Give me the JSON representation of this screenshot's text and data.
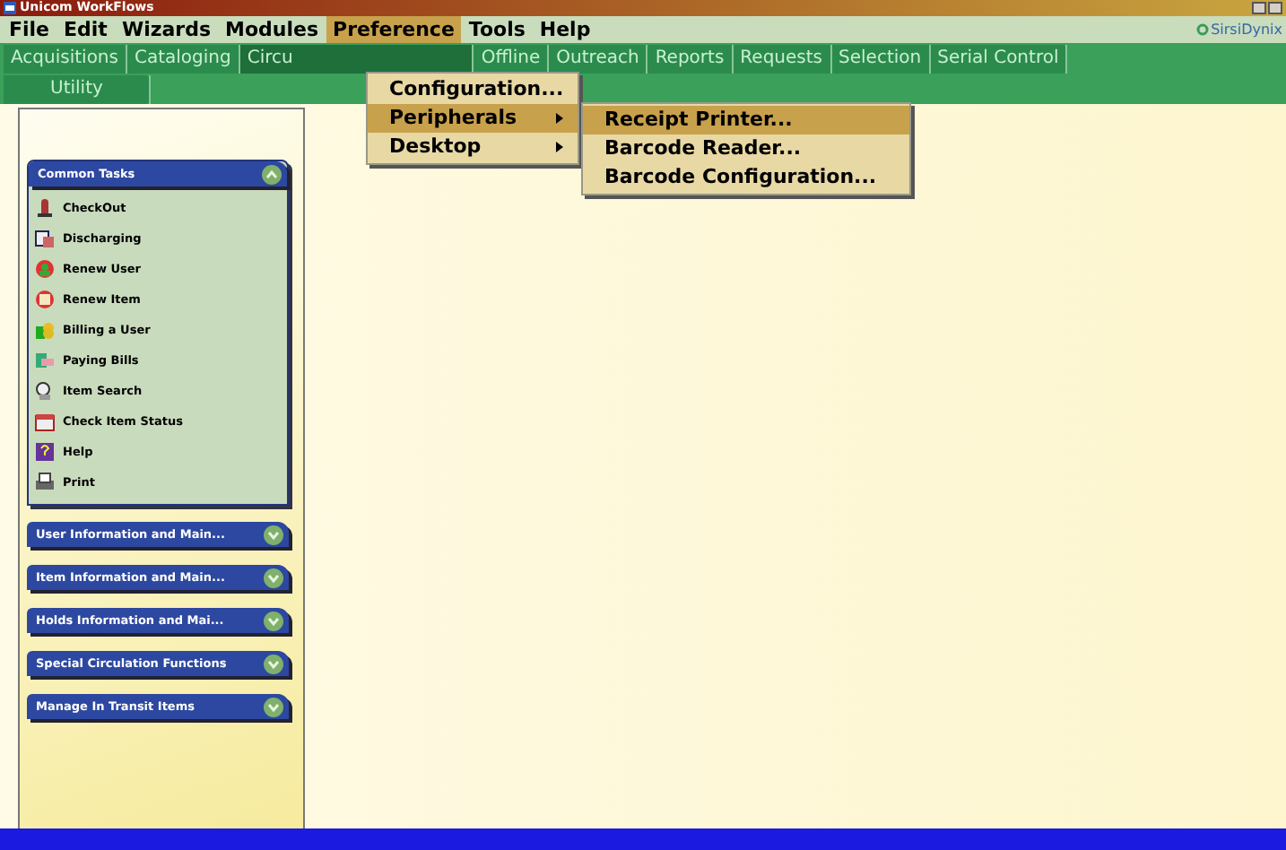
{
  "window": {
    "title": "Unicom WorkFlows",
    "logo": "SirsiDynix"
  },
  "menubar": [
    {
      "label": "File",
      "selected": false
    },
    {
      "label": "Edit",
      "selected": false
    },
    {
      "label": "Wizards",
      "selected": false
    },
    {
      "label": "Modules",
      "selected": false
    },
    {
      "label": "Preference",
      "selected": true
    },
    {
      "label": "Tools",
      "selected": false
    },
    {
      "label": "Help",
      "selected": false
    }
  ],
  "tabs": [
    [
      {
        "label": "Acquisitions",
        "selected": false
      },
      {
        "label": "Cataloging",
        "selected": false
      },
      {
        "label": "Circu",
        "selected": true
      },
      {
        "label": "Offline",
        "selected": false
      },
      {
        "label": "Outreach",
        "selected": false
      },
      {
        "label": "Reports",
        "selected": false
      },
      {
        "label": "Requests",
        "selected": false
      },
      {
        "label": "Selection",
        "selected": false
      },
      {
        "label": "Serial Control",
        "selected": false
      }
    ],
    [
      {
        "label": "Utility",
        "selected": false
      }
    ]
  ],
  "menu": [
    {
      "label": "Configuration...",
      "selected": false,
      "submenu": false
    },
    {
      "label": "Peripherals",
      "selected": true,
      "submenu": true
    },
    {
      "label": "Desktop",
      "selected": false,
      "submenu": true
    }
  ],
  "submenu": [
    {
      "label": "Receipt Printer...",
      "selected": true
    },
    {
      "label": "Barcode Reader...",
      "selected": false
    },
    {
      "label": "Barcode Configuration...",
      "selected": false
    }
  ],
  "common_tasks": {
    "title": "Common Tasks",
    "expanded": true,
    "items": [
      "CheckOut",
      "Discharging",
      "Renew User",
      "Renew Item",
      "Billing a User",
      "Paying Bills",
      "Item Search",
      "Check Item Status",
      "Help",
      "Print"
    ]
  },
  "groups": [
    {
      "title": "User Information and Main...",
      "expanded": false
    },
    {
      "title": "Item Information and Main...",
      "expanded": false
    },
    {
      "title": "Holds Information and Mai...",
      "expanded": false
    },
    {
      "title": "Special Circulation Functions",
      "expanded": false
    },
    {
      "title": "Manage In Transit Items",
      "expanded": false
    }
  ]
}
